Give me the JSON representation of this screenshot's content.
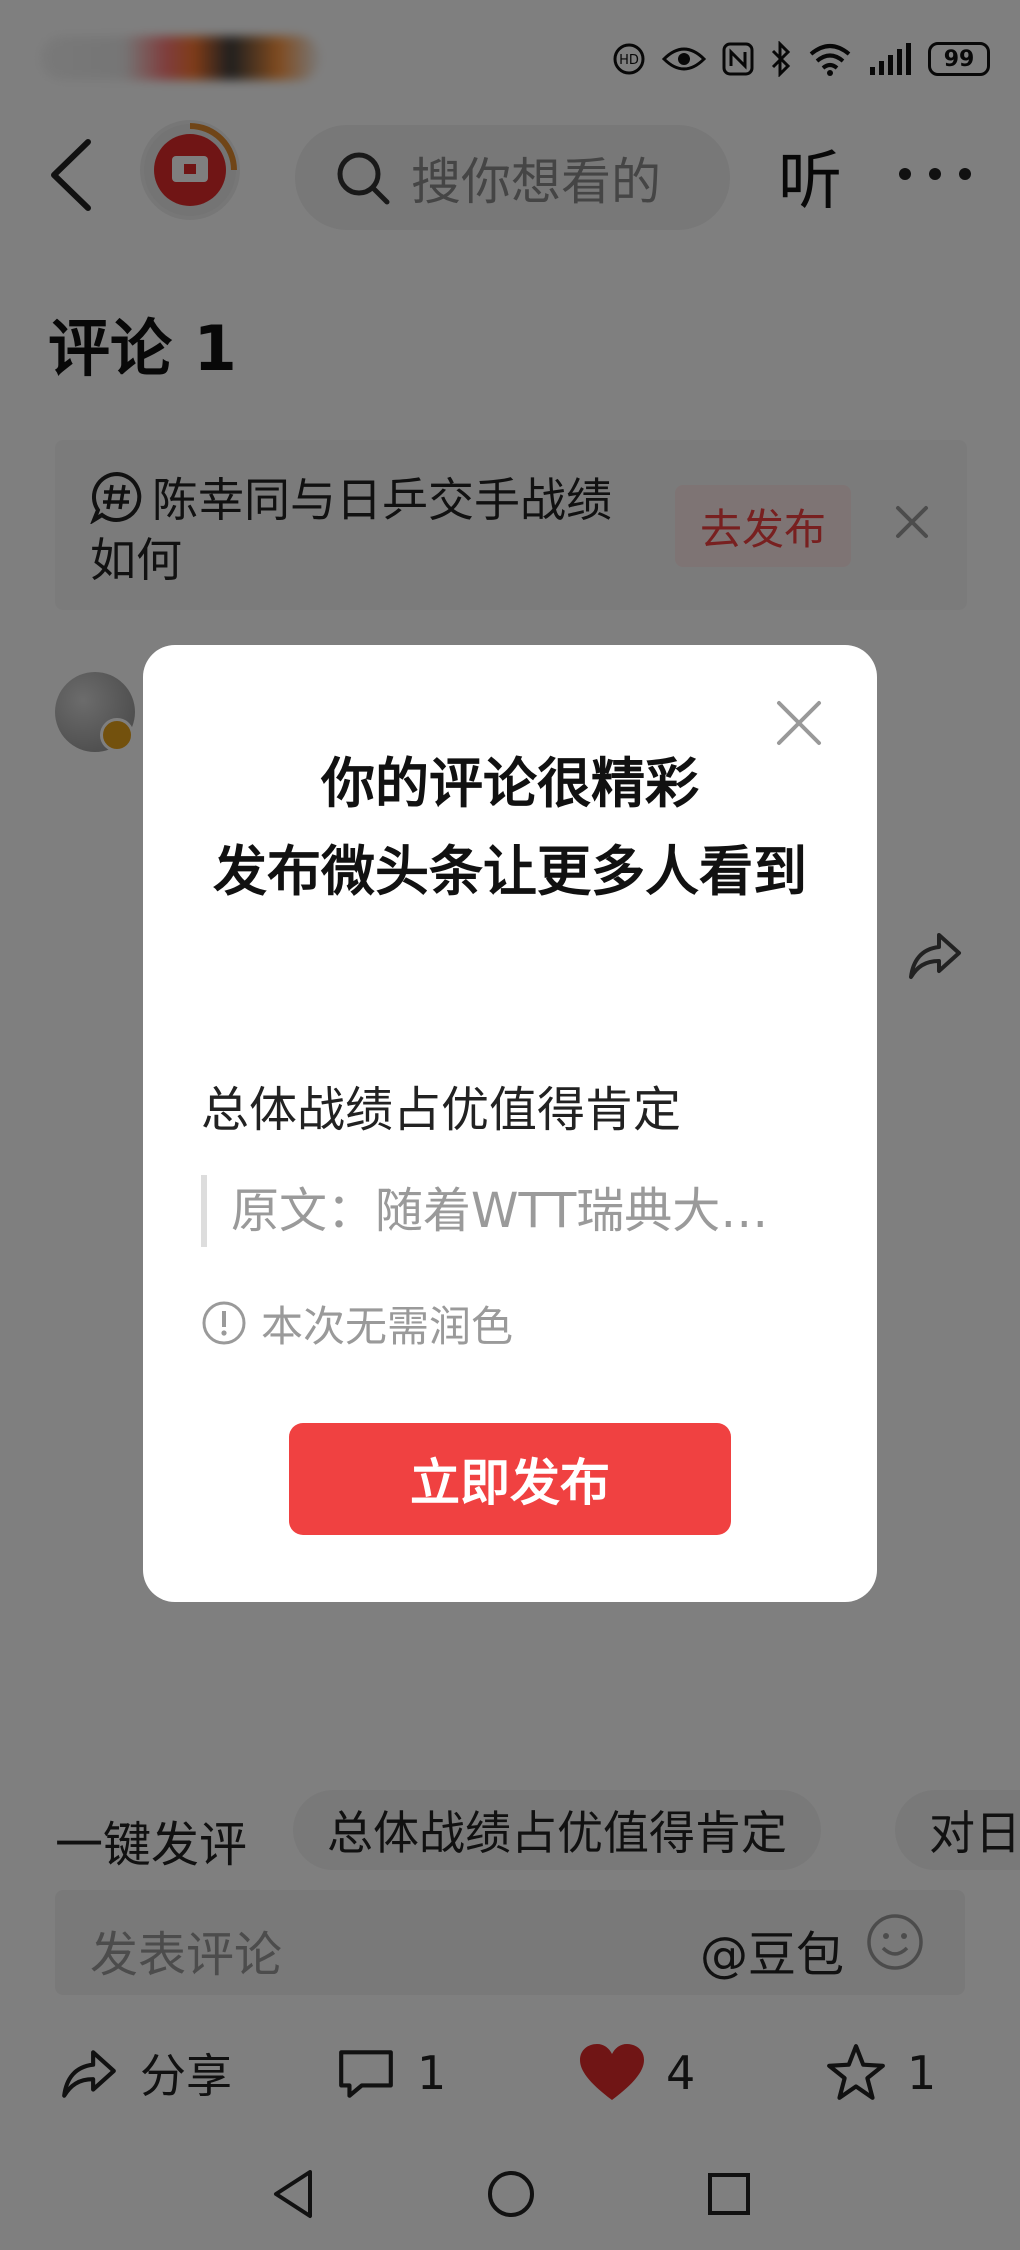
{
  "status_bar": {
    "battery": "99"
  },
  "header": {
    "search_placeholder": "搜你想看的",
    "listen_label": "听"
  },
  "comments_title": "评论 1",
  "topic": {
    "text": "陈幸同与日乒交手战绩如何",
    "button": "去发布"
  },
  "modal": {
    "title_line1": "你的评论很精彩",
    "title_line2": "发布微头条让更多人看到",
    "comment_text": "总体战绩占优值得肯定",
    "quote": "原文：随着WTT瑞典大…",
    "note": "本次无需润色",
    "publish_button": "立即发布"
  },
  "quick_reply": {
    "label": "一键发评",
    "chips": [
      "总体战绩占优值得肯定",
      "对日"
    ]
  },
  "comment_bar": {
    "placeholder": "发表评论",
    "mention": "@豆包"
  },
  "actions": {
    "share": "分享",
    "comments": "1",
    "likes": "4",
    "favorites": "1"
  },
  "colors": {
    "accent": "#f04141",
    "like": "#e02b2b"
  }
}
